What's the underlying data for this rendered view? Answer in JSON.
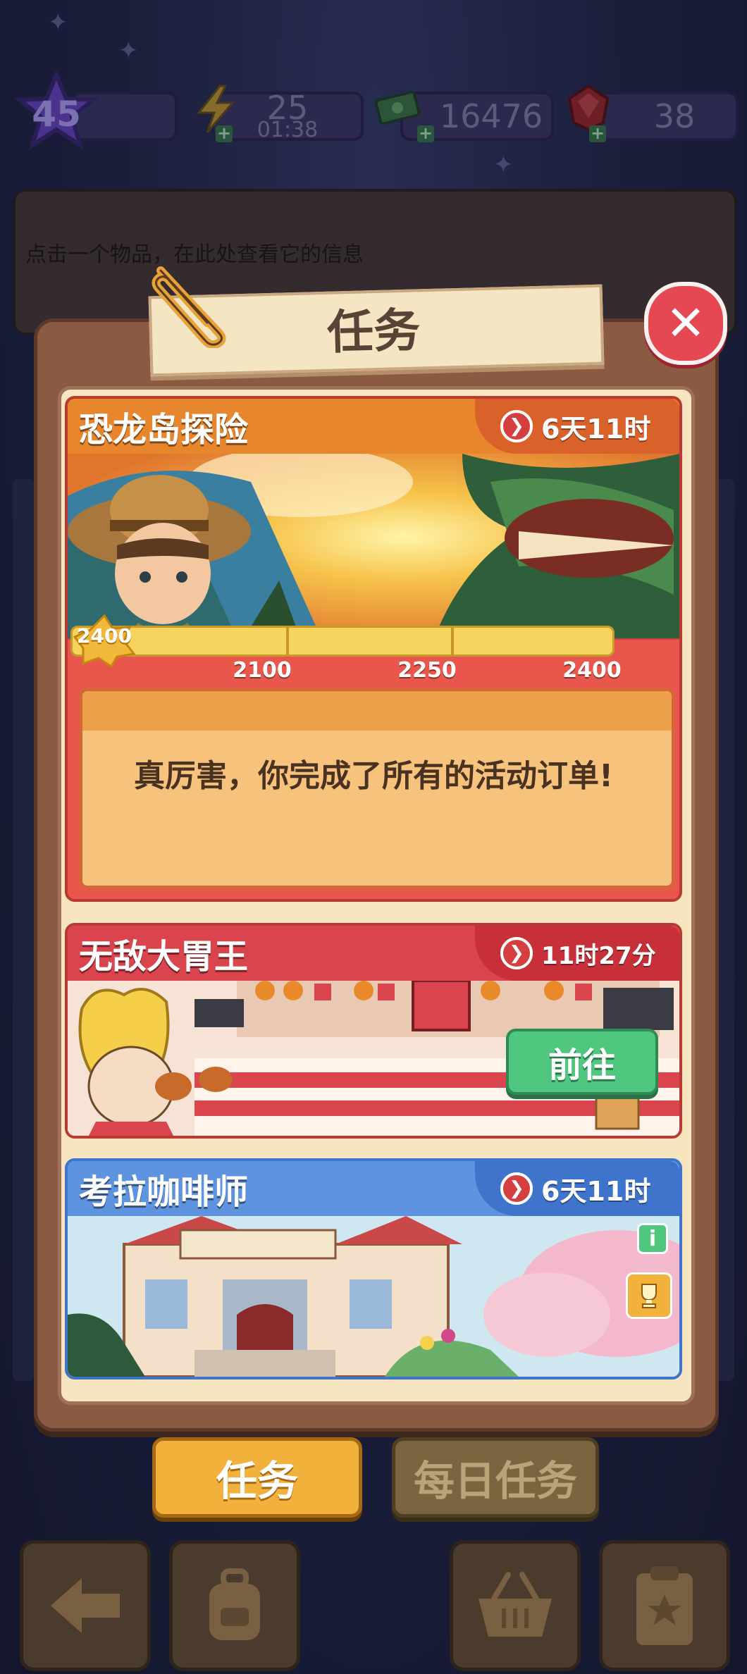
{
  "resources": {
    "level": "45",
    "energy": "25",
    "energy_timer": "01:38",
    "cash": "16476",
    "gems": "38"
  },
  "info_panel": {
    "hint": "点击一个物品，在此处查看它的信息"
  },
  "dialog": {
    "title": "任务",
    "close_symbol": "✕"
  },
  "events": [
    {
      "title": "恐龙岛探险",
      "timer": "6天11时",
      "header_color": "#e8862d",
      "timer_color": "#d9612a",
      "current_score": "2400",
      "progress_fraction": 1.0,
      "milestones": [
        "2100",
        "2250",
        "2400"
      ],
      "message": "真厉害，你完成了所有的活动订单!"
    },
    {
      "title": "无敌大胃王",
      "timer": "11时27分",
      "header_color": "#d9444d",
      "timer_color": "#c83039",
      "button_label": "前往"
    },
    {
      "title": "考拉咖啡师",
      "timer": "6天11时",
      "header_color": "#5e93e0",
      "timer_color": "#3f74cc"
    }
  ],
  "tabs": {
    "tasks": "任务",
    "daily_tasks": "每日任务"
  },
  "nav": [
    "back-icon",
    "backpack-icon",
    "basket-icon",
    "clipboard-icon"
  ]
}
